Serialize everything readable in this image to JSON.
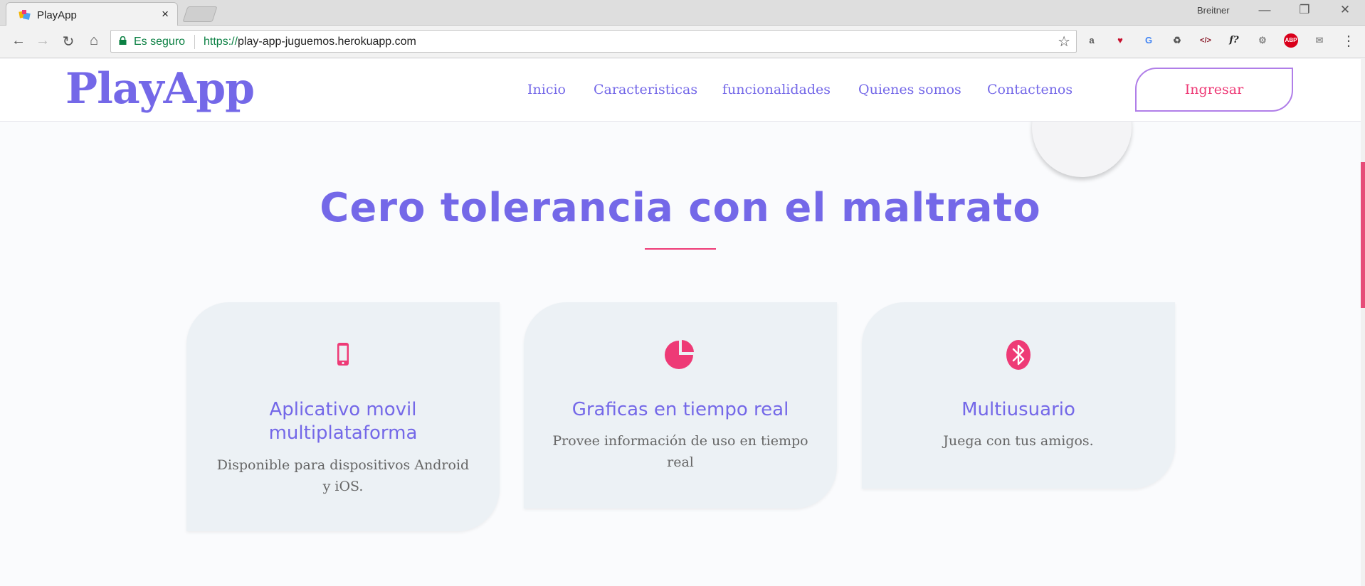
{
  "browser": {
    "tab_title": "PlayApp",
    "tab_close": "×",
    "profile_name": "Breitner",
    "secure_label": "Es seguro",
    "url_scheme": "https://",
    "url_host": "play-app-juguemos.herokuapp.com",
    "controls": {
      "minimize": "—",
      "restore": "❐",
      "close": "✕"
    },
    "nav": {
      "back": "←",
      "forward": "→",
      "reload": "↻",
      "home": "⌂"
    },
    "star": "☆",
    "extensions": [
      {
        "name": "shopping-bag-icon",
        "glyph": "a"
      },
      {
        "name": "heart-inbox-icon",
        "glyph": "♥"
      },
      {
        "name": "translate-icon",
        "glyph": "G"
      },
      {
        "name": "recycle-icon",
        "glyph": "♻"
      },
      {
        "name": "code-icon",
        "glyph": "</>"
      },
      {
        "name": "function-icon",
        "glyph": "f?"
      },
      {
        "name": "gear-icon",
        "glyph": "⚙"
      },
      {
        "name": "adblock-icon",
        "glyph": "ABP"
      },
      {
        "name": "inbox-icon",
        "glyph": "✉"
      }
    ],
    "menu": "⋮"
  },
  "site": {
    "logo": "PlayApp",
    "nav": [
      "Inicio",
      "Caracteristicas",
      "funcionalidades",
      "Quienes somos",
      "Contactenos"
    ],
    "login_button": "Ingresar"
  },
  "section": {
    "title": "Cero tolerancia con el maltrato"
  },
  "features": [
    {
      "icon": "smartphone-icon",
      "title": "Aplicativo movil multiplataforma",
      "description": "Disponible para dispositivos Android y iOS."
    },
    {
      "icon": "pie-chart-icon",
      "title": "Graficas en tiempo real",
      "description": "Provee información de uso en tiempo real"
    },
    {
      "icon": "bluetooth-icon",
      "title": "Multiusuario",
      "description": "Juega con tus amigos."
    }
  ],
  "colors": {
    "brand": "#7468e8",
    "accent": "#ee3a76",
    "card_bg": "#ecf1f5",
    "secure_green": "#0b8043"
  }
}
